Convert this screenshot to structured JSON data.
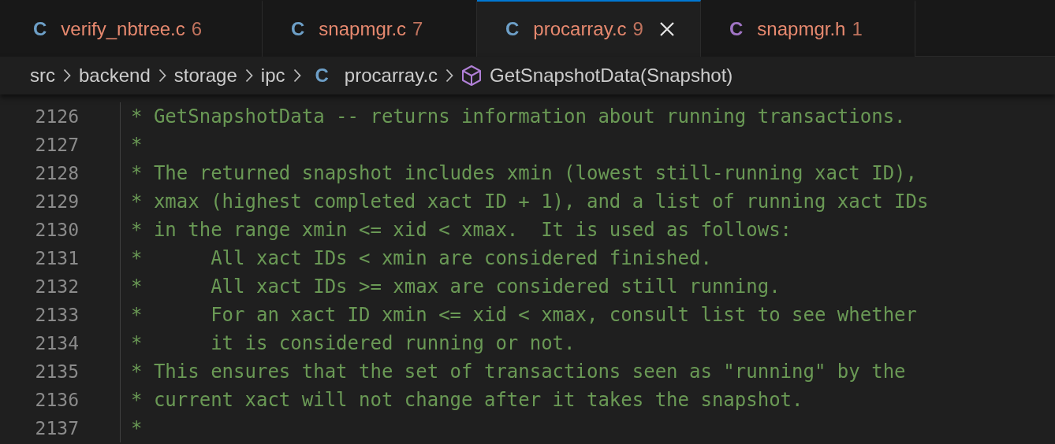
{
  "tabs": [
    {
      "icon": "C",
      "color": "#6d9fc7",
      "name": "verify_nbtree.c",
      "count": "6",
      "selected": false
    },
    {
      "icon": "C",
      "color": "#6d9fc7",
      "name": "snapmgr.c",
      "count": "7",
      "selected": false
    },
    {
      "icon": "C",
      "color": "#6d9fc7",
      "name": "procarray.c",
      "count": "9",
      "selected": true
    },
    {
      "icon": "C",
      "color": "#a074c4",
      "name": "snapmgr.h",
      "count": "1",
      "selected": false
    }
  ],
  "breadcrumb": {
    "folders": [
      "src",
      "backend",
      "storage",
      "ipc"
    ],
    "file_icon": "C",
    "file": "procarray.c",
    "symbol": "GetSnapshotData(Snapshot)"
  },
  "code_lines": [
    {
      "number": "2126",
      "text": "* GetSnapshotData -- returns information about running transactions."
    },
    {
      "number": "2127",
      "text": "*"
    },
    {
      "number": "2128",
      "text": "* The returned snapshot includes xmin (lowest still-running xact ID),"
    },
    {
      "number": "2129",
      "text": "* xmax (highest completed xact ID + 1), and a list of running xact IDs"
    },
    {
      "number": "2130",
      "text": "* in the range xmin <= xid < xmax.  It is used as follows:"
    },
    {
      "number": "2131",
      "text": "*      All xact IDs < xmin are considered finished."
    },
    {
      "number": "2132",
      "text": "*      All xact IDs >= xmax are considered still running."
    },
    {
      "number": "2133",
      "text": "*      For an xact ID xmin <= xid < xmax, consult list to see whether"
    },
    {
      "number": "2134",
      "text": "*      it is considered running or not."
    },
    {
      "number": "2135",
      "text": "* This ensures that the set of transactions seen as \"running\" by the"
    },
    {
      "number": "2136",
      "text": "* current xact will not change after it takes the snapshot."
    },
    {
      "number": "2137",
      "text": "*"
    }
  ]
}
